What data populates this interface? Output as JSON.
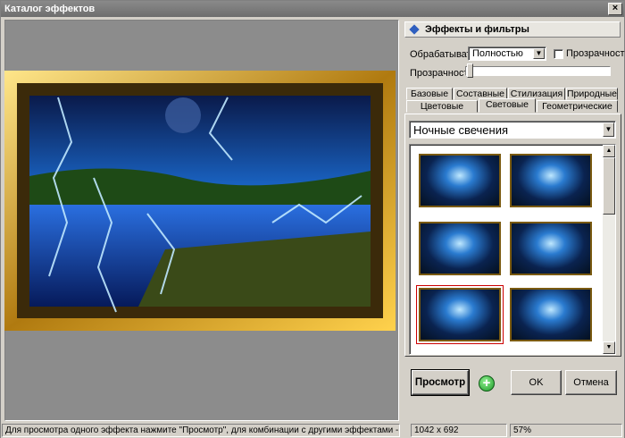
{
  "window": {
    "title": "Каталог эффектов"
  },
  "panel": {
    "header": "Эффекты и фильтры",
    "process_label": "Обрабатывать",
    "process_value": "Полностью",
    "transparency_checkbox_label": "Прозрачность",
    "transparency_slider_label": "Прозрачность",
    "transparency_value": 0,
    "tabs_row1": [
      "Базовые",
      "Составные",
      "Стилизация",
      "Природные"
    ],
    "tabs_row2": [
      "Цветовые",
      "Световые",
      "Геометрические"
    ],
    "active_tab": "Световые",
    "category": "Ночные свечения"
  },
  "buttons": {
    "preview": "Просмотр",
    "ok": "OK",
    "cancel": "Отмена"
  },
  "status": {
    "hint": "Для просмотра одного эффекта нажмите \"Просмотр\", для комбинации с другими эффектами - кнопку \"Плюс\"",
    "size": "1042 x 692",
    "zoom": "57%"
  },
  "icons": {
    "header": "diamond-icon",
    "add": "plus-icon",
    "close": "close-icon"
  }
}
